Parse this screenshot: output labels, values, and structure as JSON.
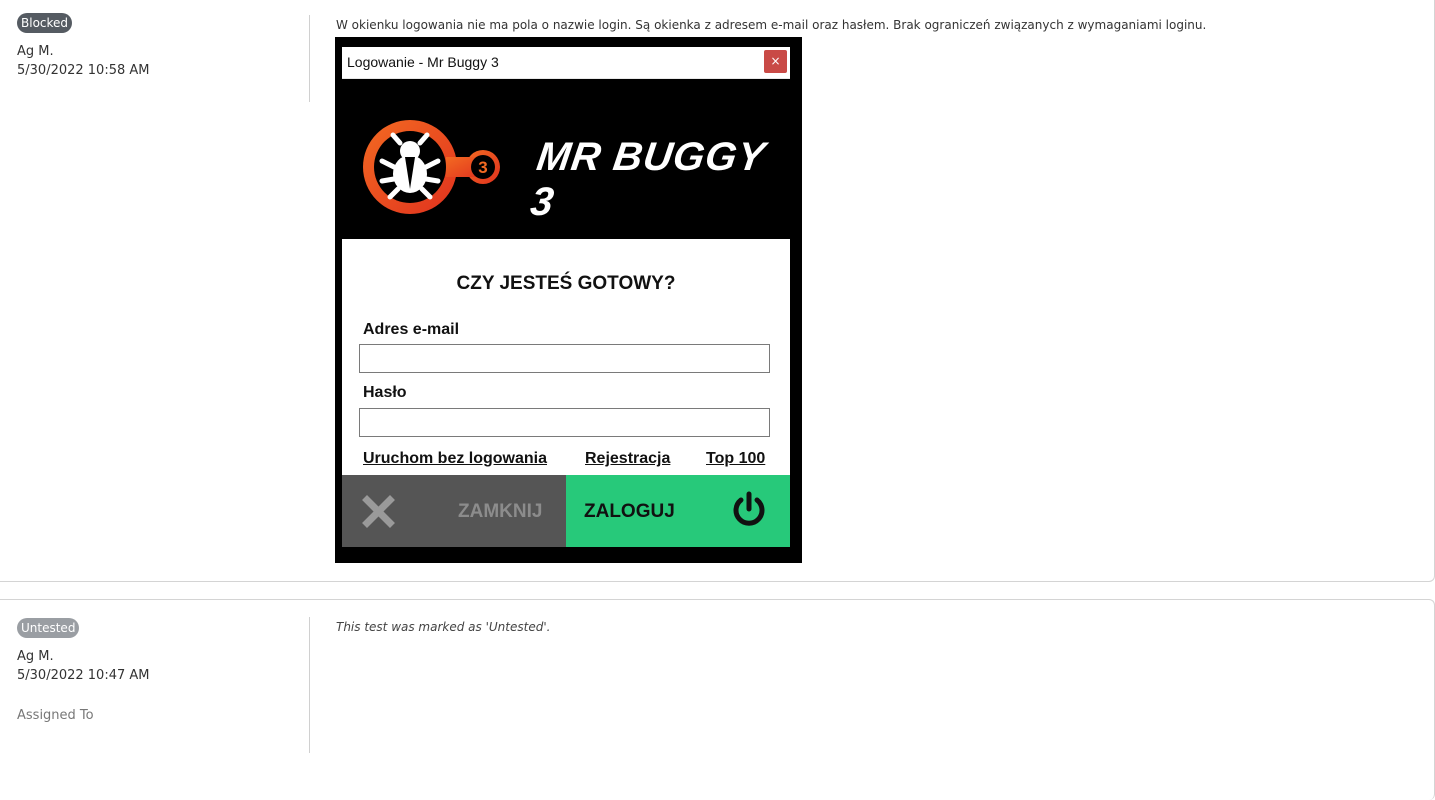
{
  "entries": [
    {
      "status": "Blocked",
      "author": "Ag M.",
      "timestamp": "5/30/2022 10:58 AM",
      "comment": "W okienku logowania nie ma pola o nazwie login. Są okienka z adresem e-mail oraz hasłem. Brak ograniczeń związanych z wymaganiami loginu.",
      "screenshot": {
        "window_title": "Logowanie - Mr Buggy 3",
        "close_symbol": "×",
        "logo_number": "3",
        "brand_text": "MR BUGGY 3",
        "heading": "CZY JESTEŚ GOTOWY?",
        "email_label": "Adres e-mail",
        "email_value": "",
        "password_label": "Hasło",
        "password_value": "",
        "links": [
          "Uruchom bez logowania",
          "Rejestracja",
          "Top 100"
        ],
        "close_button_label": "ZAMKNIJ",
        "login_button_label": "ZALOGUJ",
        "icons": [
          "bug-icon",
          "x-icon",
          "power-icon"
        ],
        "colors": {
          "accent_orange": "#f0572a",
          "login_green": "#27c97a",
          "close_gray": "#555555",
          "titlebar_close": "#c94a46"
        }
      }
    },
    {
      "status": "Untested",
      "author": "Ag M.",
      "timestamp": "5/30/2022 10:47 AM",
      "assigned_label": "Assigned To",
      "comment": "This test was marked as 'Untested'."
    }
  ],
  "colors": {
    "blocked": "#555b62",
    "untested": "#9a9ea3"
  }
}
